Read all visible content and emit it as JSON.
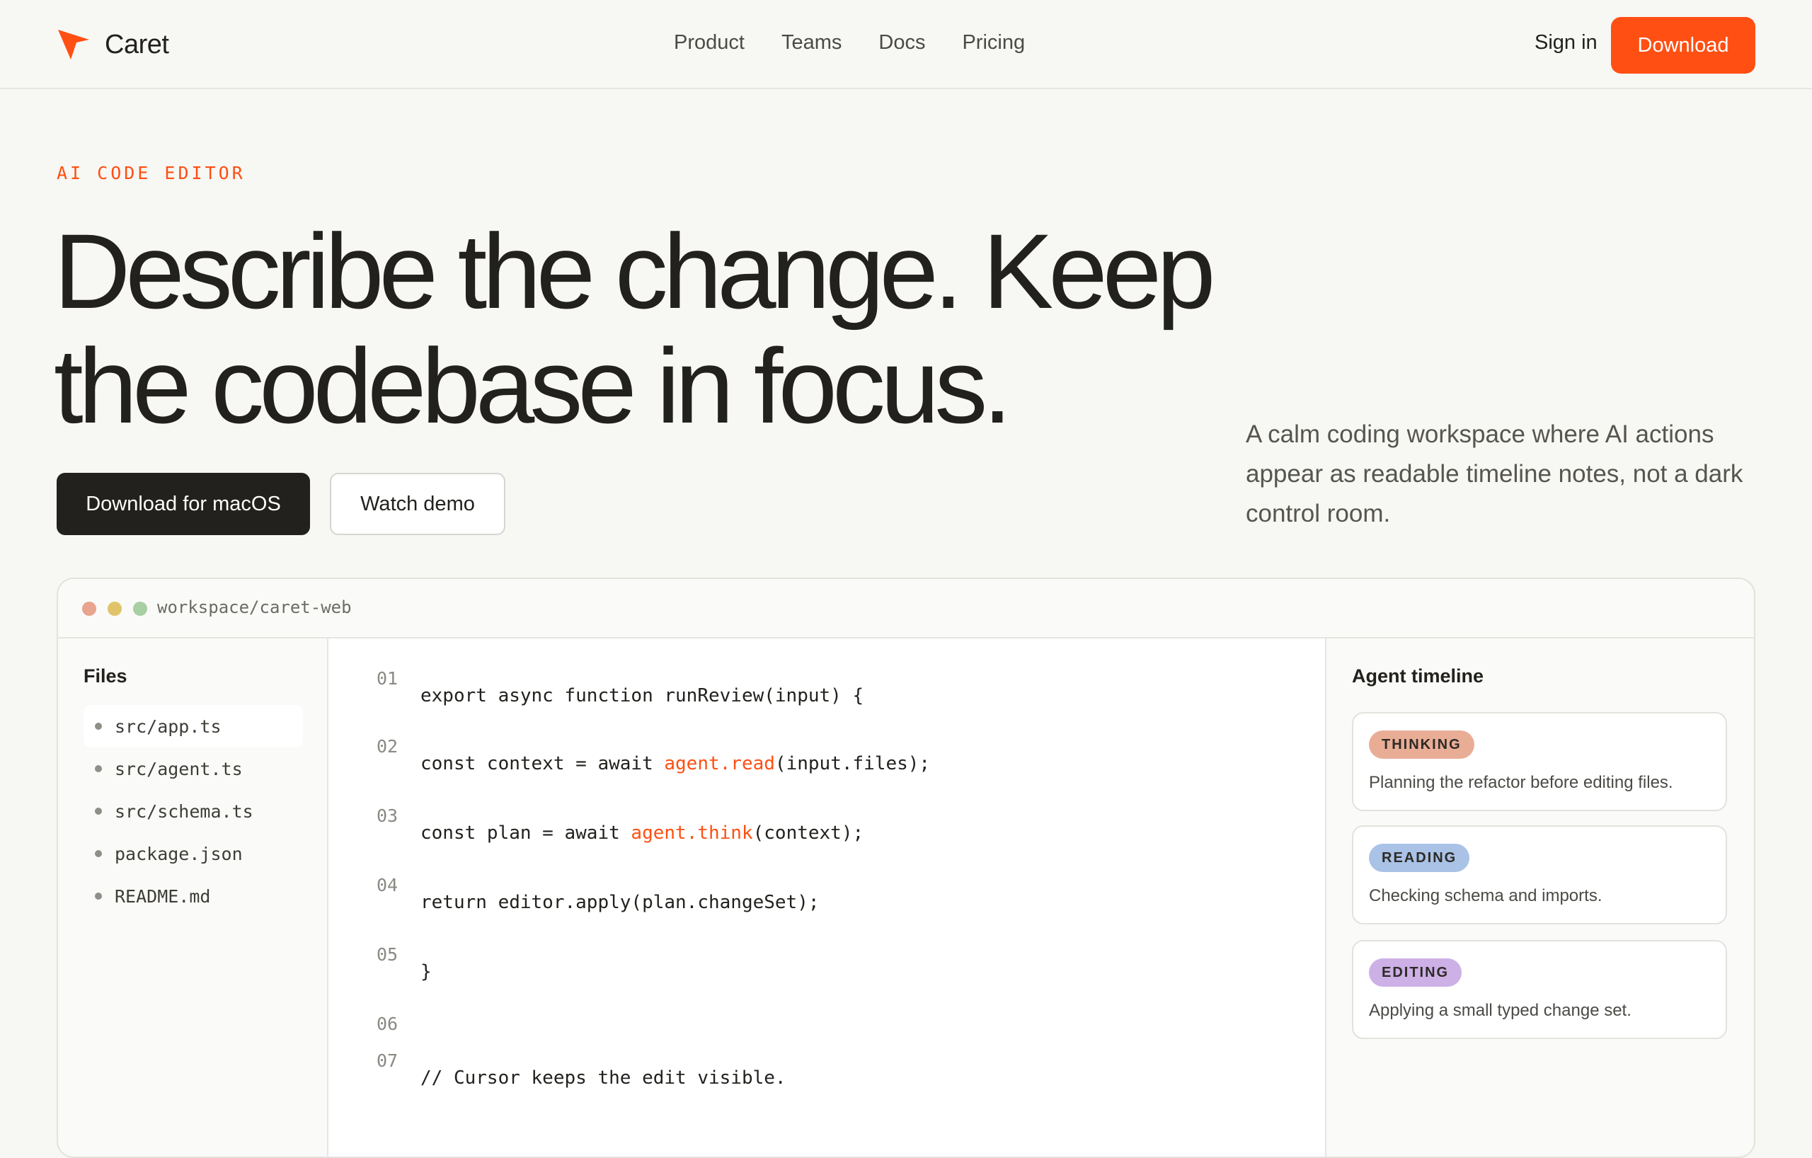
{
  "brand": {
    "name": "Caret",
    "accent": "#ff4f12"
  },
  "nav": {
    "links": [
      "Product",
      "Teams",
      "Docs",
      "Pricing"
    ],
    "sign_in": "Sign in",
    "download": "Download"
  },
  "hero": {
    "eyebrow": "AI CODE EDITOR",
    "headline_line1": "Describe the change. Keep",
    "headline_line2": "the codebase in focus.",
    "primary_cta": "Download for macOS",
    "secondary_cta": "Watch demo",
    "subtitle": "A calm coding workspace where AI actions appear as readable timeline notes, not a dark control room."
  },
  "editor": {
    "path": "workspace/caret-web",
    "files_title": "Files",
    "files": [
      "src/app.ts",
      "src/agent.ts",
      "src/schema.ts",
      "package.json",
      "README.md"
    ],
    "active_file": "src/app.ts",
    "code_lines": [
      {
        "num": "01",
        "pre": "export async function runReview(input) {",
        "hl": "",
        "post": ""
      },
      {
        "num": "02",
        "pre": "const context = await ",
        "hl": "agent.read",
        "post": "(input.files);"
      },
      {
        "num": "03",
        "pre": "const plan = await ",
        "hl": "agent.think",
        "post": "(context);"
      },
      {
        "num": "04",
        "pre": "return editor.apply(plan.changeSet);",
        "hl": "",
        "post": ""
      },
      {
        "num": "05",
        "pre": "}",
        "hl": "",
        "post": ""
      },
      {
        "num": "06",
        "pre": "",
        "hl": "",
        "post": ""
      },
      {
        "num": "07",
        "pre": "// Cursor keeps the edit visible.",
        "hl": "",
        "post": ""
      }
    ],
    "timeline_title": "Agent timeline",
    "timeline": [
      {
        "badge": "THINKING",
        "text": "Planning the refactor before editing files.",
        "color": "#e9ad96"
      },
      {
        "badge": "READING",
        "text": "Checking schema and imports.",
        "color": "#a9c2e6"
      },
      {
        "badge": "EDITING",
        "text": "Applying a small typed change set.",
        "color": "#cdb0e6"
      }
    ]
  }
}
